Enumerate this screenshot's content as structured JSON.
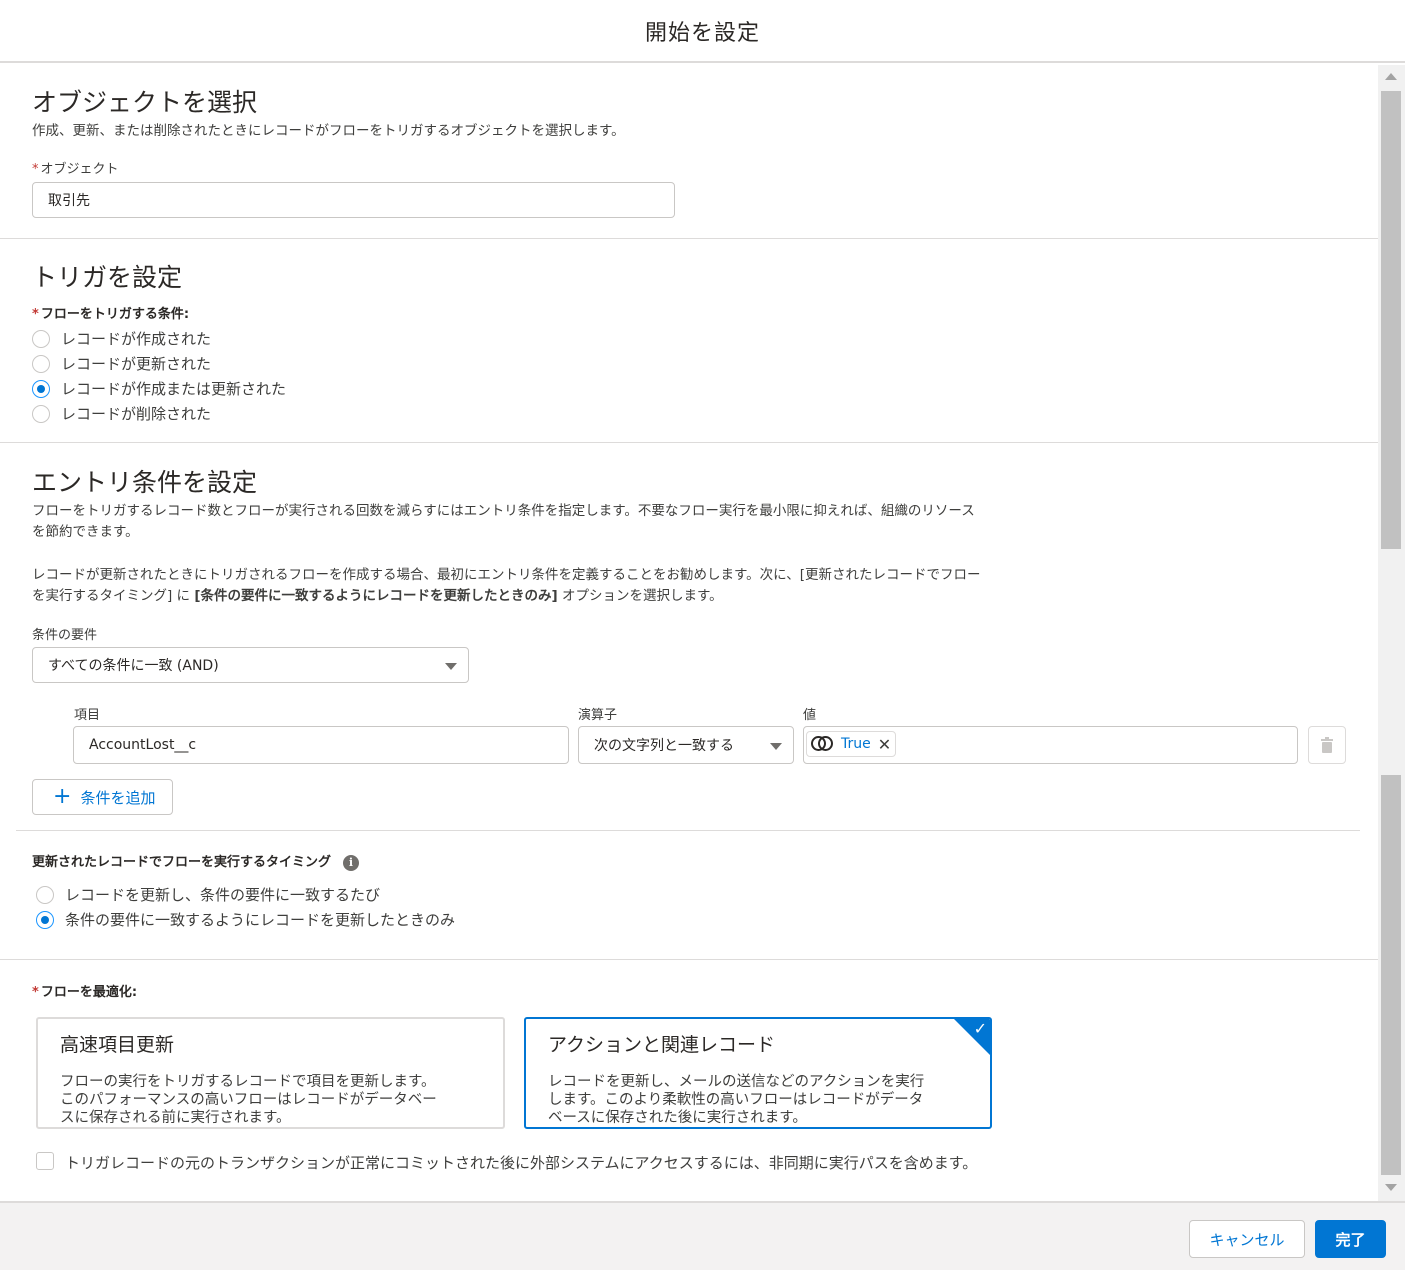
{
  "modal": {
    "title": "開始を設定"
  },
  "object_section": {
    "heading": "オブジェクトを選択",
    "description": "作成、更新、または削除されたときにレコードがフローをトリガするオブジェクトを選択します。",
    "required_mark": "*",
    "field_label": "オブジェクト",
    "field_value": "取引先"
  },
  "trigger_section": {
    "heading": "トリガを設定",
    "required_mark": "*",
    "field_label": "フローをトリガする条件:",
    "options": [
      {
        "label": "レコードが作成された",
        "checked": false
      },
      {
        "label": "レコードが更新された",
        "checked": false
      },
      {
        "label": "レコードが作成または更新された",
        "checked": true
      },
      {
        "label": "レコードが削除された",
        "checked": false
      }
    ]
  },
  "entry_section": {
    "heading": "エントリ条件を設定",
    "desc1_line1": "フローをトリガするレコード数とフローが実行される回数を減らすにはエントリ条件を指定します。不要なフロー実行を最小限に抑えれば、組織のリソース",
    "desc1_line2": "を節約できます。",
    "desc2_line1": "レコードが更新されたときにトリガされるフローを作成する場合、最初にエントリ条件を定義することをお勧めします。次に、[更新されたレコードでフロー",
    "desc2_line2_prefix": "を実行するタイミング] に ",
    "desc2_line2_bold": "[条件の要件に一致するようにレコードを更新したときのみ]",
    "desc2_line2_suffix": " オプションを選択します。",
    "requirement_label": "条件の要件",
    "requirement_value": "すべての条件に一致 (AND)",
    "condition": {
      "field_label": "項目",
      "field_value": "AccountLost__c",
      "operator_label": "演算子",
      "operator_value": "次の文字列と一致する",
      "value_label": "値",
      "value_pill": "True",
      "value_pill_close": "✕"
    },
    "add_condition_label": "条件を追加",
    "add_condition_icon": "+"
  },
  "timing_section": {
    "label": "更新されたレコードでフローを実行するタイミング",
    "info_icon": "i",
    "options": [
      {
        "label": "レコードを更新し、条件の要件に一致するたび",
        "checked": false
      },
      {
        "label": "条件の要件に一致するようにレコードを更新したときのみ",
        "checked": true
      }
    ]
  },
  "optimize_section": {
    "required_mark": "*",
    "label": "フローを最適化:",
    "cards": [
      {
        "title": "高速項目更新",
        "desc_lines": [
          "フローの実行をトリガするレコードで項目を更新します。",
          "このパフォーマンスの高いフローはレコードがデータベー",
          "スに保存される前に実行されます。"
        ],
        "selected": false
      },
      {
        "title": "アクションと関連レコード",
        "desc_lines": [
          "レコードを更新し、メールの送信などのアクションを実行",
          "します。このより柔軟性の高いフローはレコードがデータ",
          "ベースに保存された後に実行されます。"
        ],
        "selected": true
      }
    ],
    "check_mark": "✓",
    "async_checkbox_label": "トリガレコードの元のトランザクションが正常にコミットされた後に外部システムにアクセスするには、非同期に実行パスを含めます。",
    "async_checked": false
  },
  "footer": {
    "cancel_label": "キャンセル",
    "done_label": "完了"
  },
  "colors": {
    "brand": "#0176d3",
    "required": "#c23934",
    "border": "#dddbda"
  },
  "icons": {
    "caret": "chevron-down-icon",
    "trash": "trash-icon",
    "boolean": "toggle-boolean-icon",
    "info": "info-icon",
    "plus": "add-icon"
  }
}
